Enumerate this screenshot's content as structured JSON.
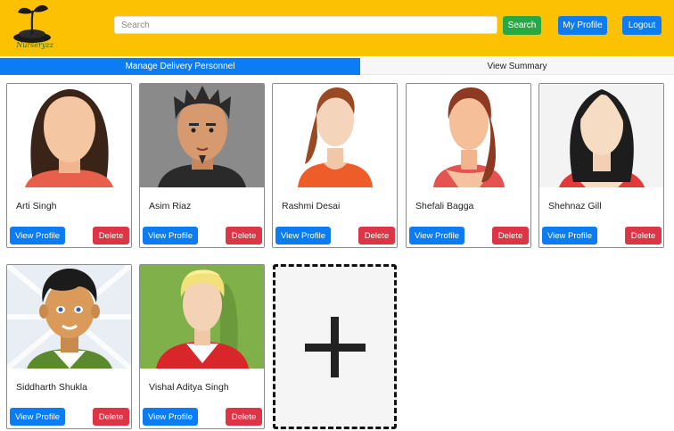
{
  "header": {
    "logo_text": "Nurseryzz",
    "search_placeholder": "Search",
    "search_label": "Search",
    "my_profile_label": "My Profile",
    "logout_label": "Logout"
  },
  "tabs": [
    {
      "label": "Manage Delivery Personnel",
      "active": true
    },
    {
      "label": "View Summary",
      "active": false
    }
  ],
  "personnel": [
    {
      "name": "Arti Singh",
      "view_label": "View Profile",
      "delete_label": "Delete"
    },
    {
      "name": "Asim Riaz",
      "view_label": "View Profile",
      "delete_label": "Delete"
    },
    {
      "name": "Rashmi Desai",
      "view_label": "View Profile",
      "delete_label": "Delete"
    },
    {
      "name": "Shefali Bagga",
      "view_label": "View Profile",
      "delete_label": "Delete"
    },
    {
      "name": "Shehnaz Gill",
      "view_label": "View Profile",
      "delete_label": "Delete"
    },
    {
      "name": "Siddharth Shukla",
      "view_label": "View Profile",
      "delete_label": "Delete"
    },
    {
      "name": "Vishal Aditya Singh",
      "view_label": "View Profile",
      "delete_label": "Delete"
    }
  ],
  "add_card_icon": "plus-icon",
  "colors": {
    "header_bg": "#fdc104",
    "primary": "#0d7bf2",
    "success": "#28a745",
    "danger": "#dc3545"
  }
}
